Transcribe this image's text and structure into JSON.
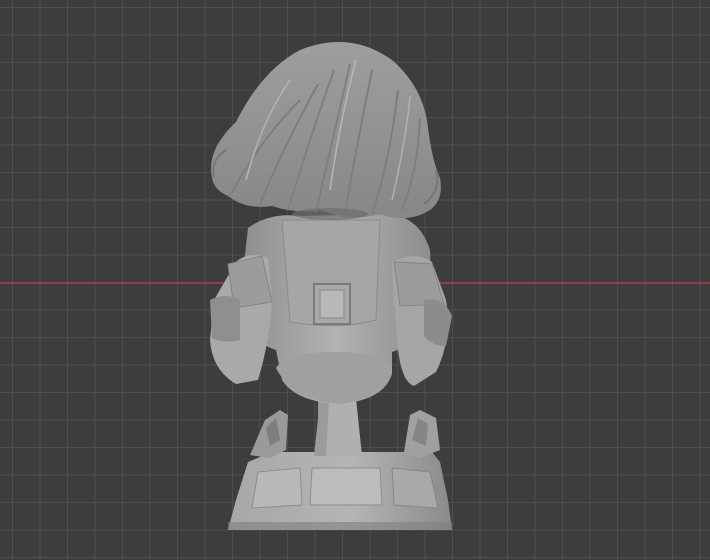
{
  "viewport": {
    "background_color": "#3d3d3d",
    "grid_color": "#505050",
    "x_axis_color": "#9b3a48",
    "model_color": "#a3a3a3"
  }
}
